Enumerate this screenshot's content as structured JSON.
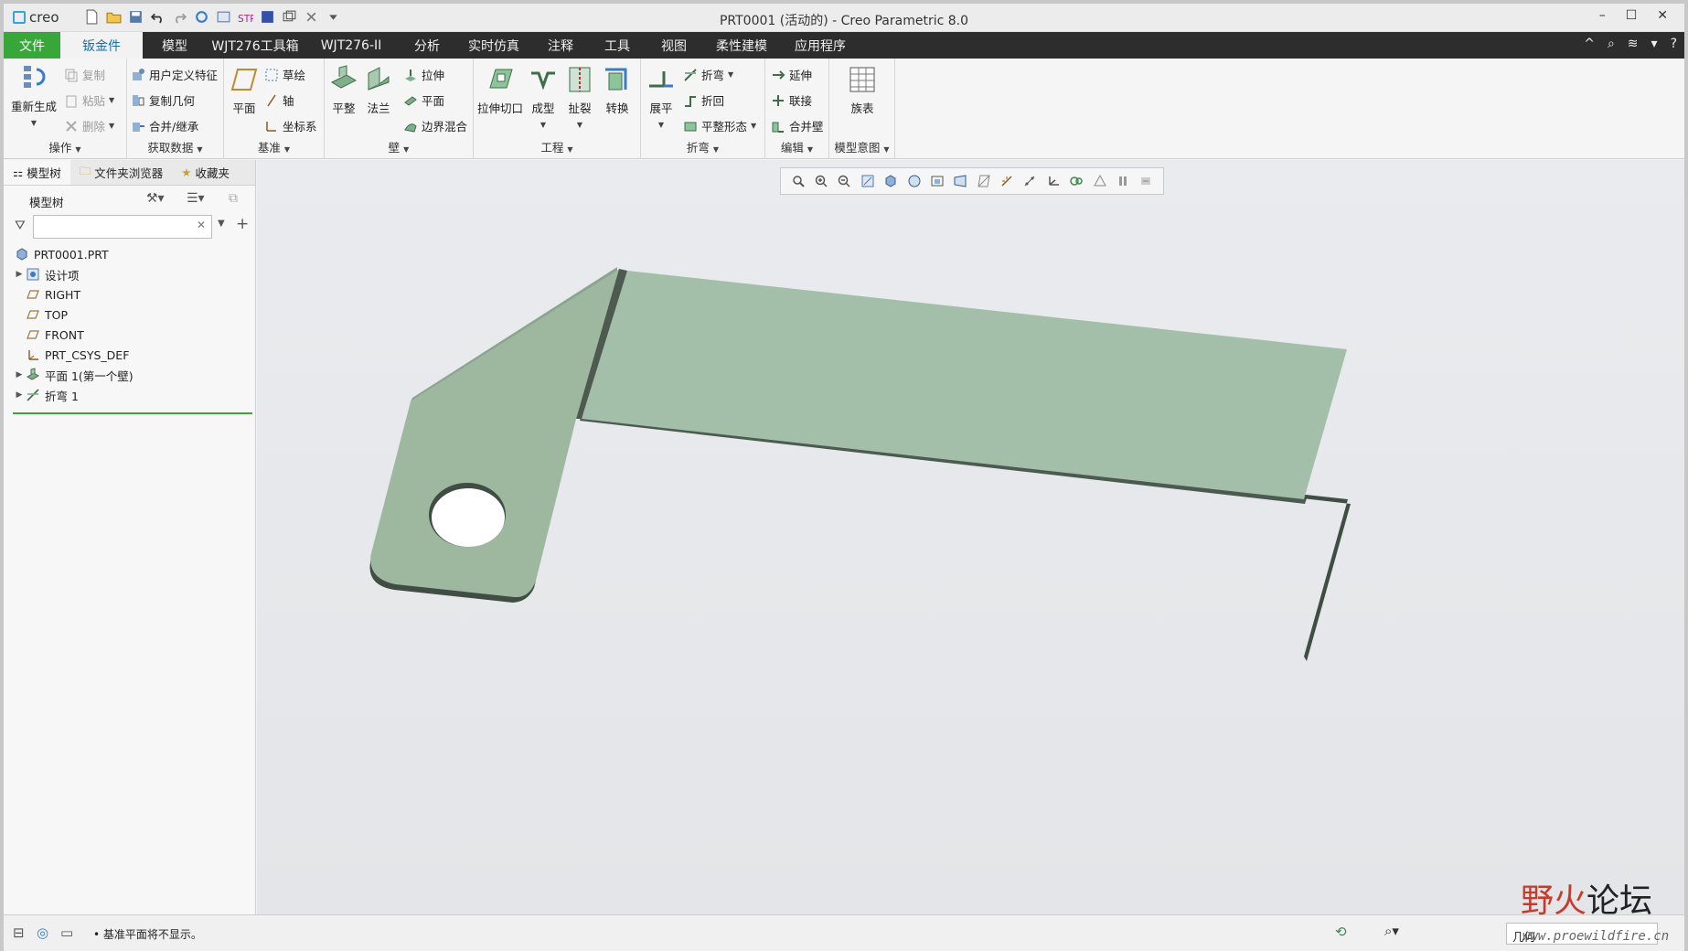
{
  "app": {
    "logo": "creo",
    "window_title": "PRT0001 (活动的) - Creo Parametric 8.0"
  },
  "window_controls": {
    "minimize": "–",
    "maximize": "☐",
    "close": "✕"
  },
  "menu": {
    "tabs": [
      "文件",
      "钣金件",
      "模型",
      "WJT276工具箱",
      "WJT276-II",
      "分析",
      "实时仿真",
      "注释",
      "工具",
      "视图",
      "柔性建模",
      "应用程序"
    ],
    "right": [
      "^",
      "⌕",
      "≋",
      "▾",
      "?"
    ]
  },
  "ribbon": {
    "ops": {
      "regen": "重新生成",
      "copy": "复制",
      "paste": "粘贴",
      "delete": "删除",
      "label": "操作"
    },
    "get": {
      "udf": "用户定义特征",
      "copygeom": "复制几何",
      "merge": "合并/继承",
      "label": "获取数据"
    },
    "datum": {
      "plane": "平面",
      "sketch": "草绘",
      "axis": "轴",
      "csys": "坐标系",
      "label": "基准"
    },
    "wall": {
      "flat": "平整",
      "flange": "法兰",
      "extrude": "拉伸",
      "planar": "平面",
      "blend": "边界混合",
      "label": "壁"
    },
    "eng": {
      "cut": "拉伸切口",
      "form": "成型",
      "rip": "扯裂",
      "convert": "转换",
      "label": "工程"
    },
    "bend": {
      "unbend": "展平",
      "bend": "折弯",
      "bendback": "折回",
      "flatstate": "平整形态",
      "label": "折弯"
    },
    "edit": {
      "extend": "延伸",
      "join": "联接",
      "mergewall": "合并壁",
      "label": "编辑"
    },
    "intent": {
      "family": "族表",
      "label": "模型意图"
    }
  },
  "panel": {
    "tabs": [
      "模型树",
      "文件夹浏览器",
      "收藏夹"
    ],
    "tree_title": "模型树",
    "filter_placeholder": "",
    "items": [
      {
        "label": "PRT0001.PRT",
        "icon": "part-icon",
        "expandable": false
      },
      {
        "label": "设计项",
        "icon": "design-items-icon",
        "expandable": true
      },
      {
        "label": "RIGHT",
        "icon": "datum-plane-icon",
        "expandable": false
      },
      {
        "label": "TOP",
        "icon": "datum-plane-icon",
        "expandable": false
      },
      {
        "label": "FRONT",
        "icon": "datum-plane-icon",
        "expandable": false
      },
      {
        "label": "PRT_CSYS_DEF",
        "icon": "csys-icon",
        "expandable": false
      },
      {
        "label": "平面 1(第一个壁)",
        "icon": "flat-wall-icon",
        "expandable": true
      },
      {
        "label": "折弯 1",
        "icon": "bend-icon",
        "expandable": true
      }
    ]
  },
  "status": {
    "message": "• 基准平面将不显示。",
    "selection_filter": "几何"
  },
  "watermark": {
    "text": "野火论坛",
    "url": "www.proewildfire.cn"
  },
  "colors": {
    "menu_bg": "#2d2d2d",
    "file_tab": "#38a73a",
    "part_face": "#a3bfaa",
    "part_edge": "#4c5a50",
    "tree_divider": "#3aa53a"
  }
}
